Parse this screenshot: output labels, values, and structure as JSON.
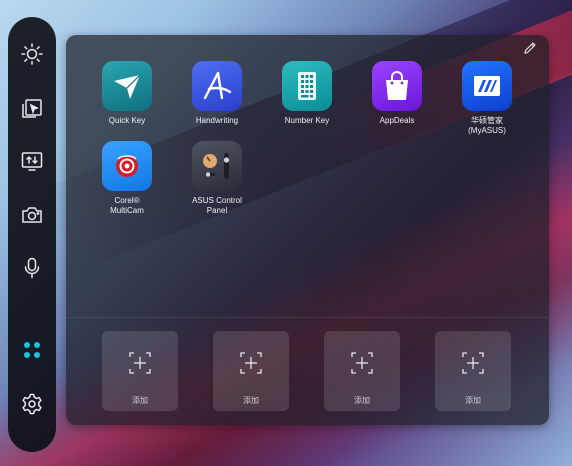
{
  "sidebar": {
    "items": [
      {
        "name": "brightness",
        "icon": "sun-icon"
      },
      {
        "name": "screenxpert",
        "icon": "window-cursor-icon"
      },
      {
        "name": "screen-transfer",
        "icon": "screen-arrows-icon"
      },
      {
        "name": "screenshot",
        "icon": "camera-icon"
      },
      {
        "name": "microphone",
        "icon": "microphone-icon"
      },
      {
        "name": "apps",
        "icon": "dots-grid-icon",
        "active": true
      },
      {
        "name": "settings",
        "icon": "gear-icon"
      }
    ],
    "accent_color": "#18c6d9"
  },
  "panel": {
    "edit_icon": "pencil-icon",
    "apps": [
      {
        "label": "Quick Key",
        "icon": "quick-key-icon"
      },
      {
        "label": "Handwriting",
        "icon": "handwriting-icon"
      },
      {
        "label": "Number Key",
        "icon": "number-key-icon"
      },
      {
        "label": "AppDeals",
        "icon": "appdeals-icon"
      },
      {
        "label": "华硕管家\n(MyASUS)",
        "icon": "myasus-icon"
      },
      {
        "label": "Corel®\nMultiCam",
        "icon": "corel-multicam-icon"
      },
      {
        "label": "ASUS Control\nPanel",
        "icon": "asus-control-panel-icon"
      }
    ],
    "slots": [
      {
        "label": "添加"
      },
      {
        "label": "添加"
      },
      {
        "label": "添加"
      },
      {
        "label": "添加"
      }
    ]
  }
}
